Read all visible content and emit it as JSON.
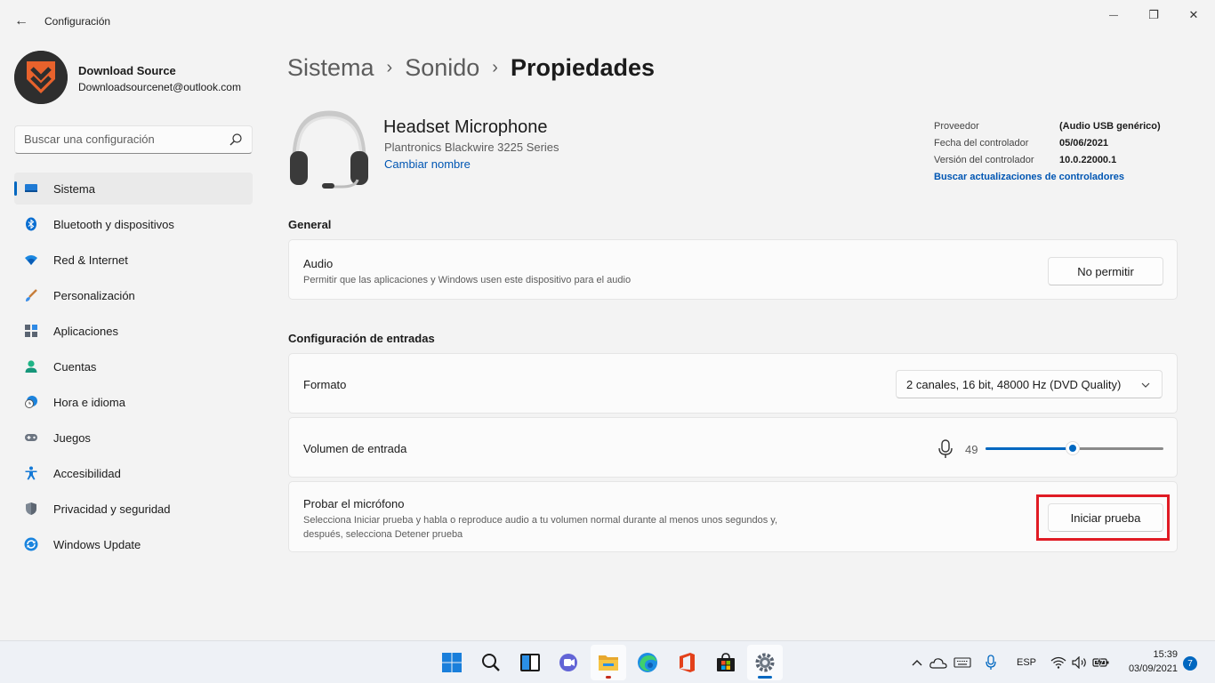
{
  "window": {
    "title": "Configuración",
    "back_glyph": "←",
    "minimize_glyph": "—",
    "maximize_glyph": "❐",
    "close_glyph": "✕"
  },
  "user": {
    "name": "Download Source",
    "email": "Downloadsourcenet@outlook.com"
  },
  "search": {
    "placeholder": "Buscar una configuración"
  },
  "sidebar": {
    "items": [
      {
        "label": "Sistema",
        "icon": "system-icon",
        "active": true
      },
      {
        "label": "Bluetooth y dispositivos",
        "icon": "bluetooth-icon"
      },
      {
        "label": "Red & Internet",
        "icon": "wifi-icon"
      },
      {
        "label": "Personalización",
        "icon": "brush-icon"
      },
      {
        "label": "Aplicaciones",
        "icon": "apps-icon"
      },
      {
        "label": "Cuentas",
        "icon": "account-icon"
      },
      {
        "label": "Hora e idioma",
        "icon": "clock-globe-icon"
      },
      {
        "label": "Juegos",
        "icon": "gamepad-icon"
      },
      {
        "label": "Accesibilidad",
        "icon": "accessibility-icon"
      },
      {
        "label": "Privacidad y seguridad",
        "icon": "shield-icon"
      },
      {
        "label": "Windows Update",
        "icon": "update-icon"
      }
    ]
  },
  "breadcrumb": {
    "items": [
      "Sistema",
      "Sonido",
      "Propiedades"
    ],
    "separator": "›"
  },
  "device": {
    "name": "Headset Microphone",
    "model": "Plantronics Blackwire 3225 Series",
    "rename_link": "Cambiar nombre",
    "properties": [
      {
        "key": "Proveedor",
        "value": "(Audio USB genérico)"
      },
      {
        "key": "Fecha del controlador",
        "value": "05/06/2021"
      },
      {
        "key": "Versión del controlador",
        "value": "10.0.22000.1"
      }
    ],
    "update_link": "Buscar actualizaciones de controladores"
  },
  "general": {
    "title": "General",
    "audio": {
      "title": "Audio",
      "description": "Permitir que las aplicaciones y Windows usen este dispositivo para el audio",
      "button": "No permitir"
    }
  },
  "input": {
    "title": "Configuración de entradas",
    "format": {
      "title": "Formato",
      "value": "2 canales, 16 bit, 48000 Hz (DVD Quality)"
    },
    "volume": {
      "title": "Volumen de entrada",
      "value": 49,
      "value_label": "49"
    },
    "test": {
      "title": "Probar el micrófono",
      "description_line1": "Selecciona Iniciar prueba y habla o reproduce audio a tu volumen normal durante al menos unos segundos y,",
      "description_line2": "después, selecciona Detener prueba",
      "button": "Iniciar prueba"
    }
  },
  "taskbar": {
    "language": "ESP",
    "time": "15:39",
    "date": "03/09/2021",
    "notification_count": "7"
  },
  "colors": {
    "accent": "#0067c0",
    "highlight": "#e01b24"
  }
}
